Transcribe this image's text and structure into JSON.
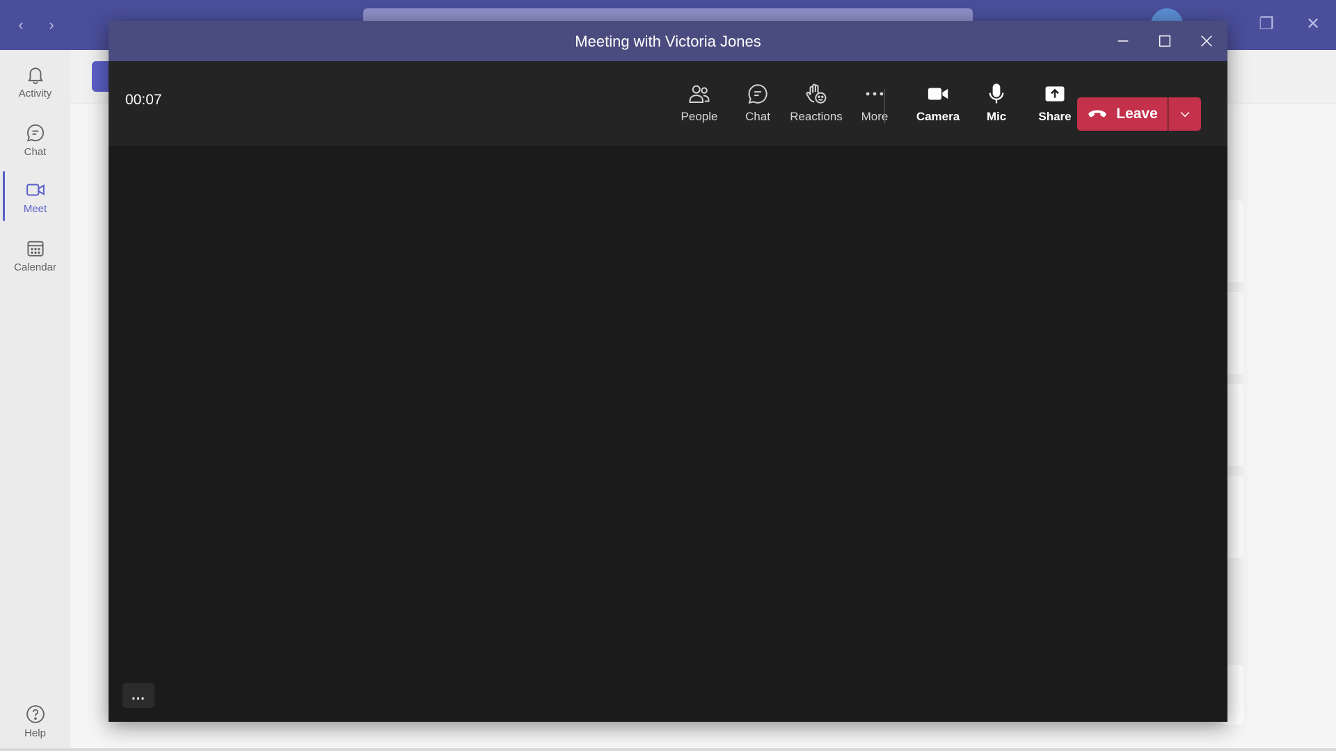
{
  "app": {
    "rail": [
      {
        "label": "Activity",
        "icon": "bell-icon"
      },
      {
        "label": "Chat",
        "icon": "chat-icon"
      },
      {
        "label": "Meet",
        "icon": "video-icon",
        "active": true
      },
      {
        "label": "Calendar",
        "icon": "calendar-icon"
      }
    ],
    "help_label": "Help"
  },
  "meeting": {
    "title": "Meeting with Victoria Jones",
    "timer": "00:07",
    "tools": {
      "people": "People",
      "chat": "Chat",
      "reactions": "Reactions",
      "more": "More",
      "camera": "Camera",
      "mic": "Mic",
      "share": "Share"
    },
    "leave_label": "Leave",
    "overflow_label": "..."
  },
  "colors": {
    "accent": "#5b5fc7",
    "title_bar": "#4a4c7f",
    "leave": "#c4314b",
    "stage": "#1b1b1b"
  }
}
